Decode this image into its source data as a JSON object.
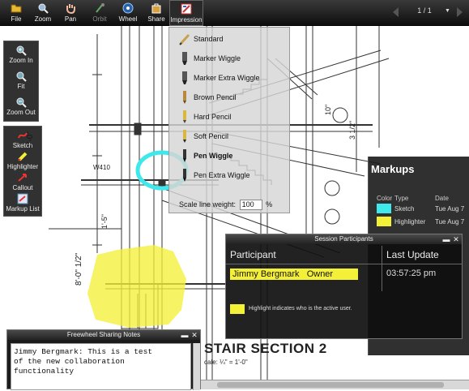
{
  "toolbar": {
    "file": "File",
    "zoom": "Zoom",
    "pan": "Pan",
    "orbit": "Orbit",
    "wheel": "Wheel",
    "share": "Share",
    "impression": "Impression",
    "page_count": "1 / 1"
  },
  "view_palette": {
    "zoom_in": "Zoom In",
    "fit": "Fit",
    "zoom_out": "Zoom Out"
  },
  "markup_palette": {
    "sketch": "Sketch",
    "highlighter": "Highlighter",
    "callout": "Callout",
    "markup_list": "Markup List"
  },
  "impression_menu": {
    "items": [
      "Standard",
      "Marker Wiggle",
      "Marker Extra Wiggle",
      "Brown Pencil",
      "Hard Pencil",
      "Soft Pencil",
      "Pen Wiggle",
      "Pen Extra Wiggle"
    ],
    "scale_label": "Scale line weight:",
    "scale_value": "100",
    "scale_unit": "%"
  },
  "markups": {
    "title": "Markups",
    "col_color": "Color",
    "col_type": "Type",
    "col_date": "Date",
    "rows": [
      {
        "type": "Sketch",
        "date": "Tue Aug 7",
        "color": "#3fe8ea"
      },
      {
        "type": "Highlighter",
        "date": "Tue Aug 7",
        "color": "#f4f038"
      }
    ]
  },
  "session": {
    "title": "Session Participants",
    "col_participant": "Participant",
    "col_last_update": "Last Update",
    "participant_name": "Jimmy Bergmark",
    "participant_role": "Owner",
    "last_update": "03:57:25 pm",
    "legend_note": "Highlight indicates who is the active user."
  },
  "notes": {
    "title": "Freewheel Sharing Notes",
    "text": "Jimmy Bergmark: This is a test\nof the new collaboration\nfunctionality"
  },
  "drawing": {
    "label_w410": "W410",
    "section_title": "STAIR SECTION 2",
    "scale_note": "cale: ¼\" = 1'-0\""
  },
  "colors": {
    "toolbar": "#1a1a1a",
    "highlight_yellow": "#f4f038",
    "sketch_cyan": "#3fe8ea"
  }
}
